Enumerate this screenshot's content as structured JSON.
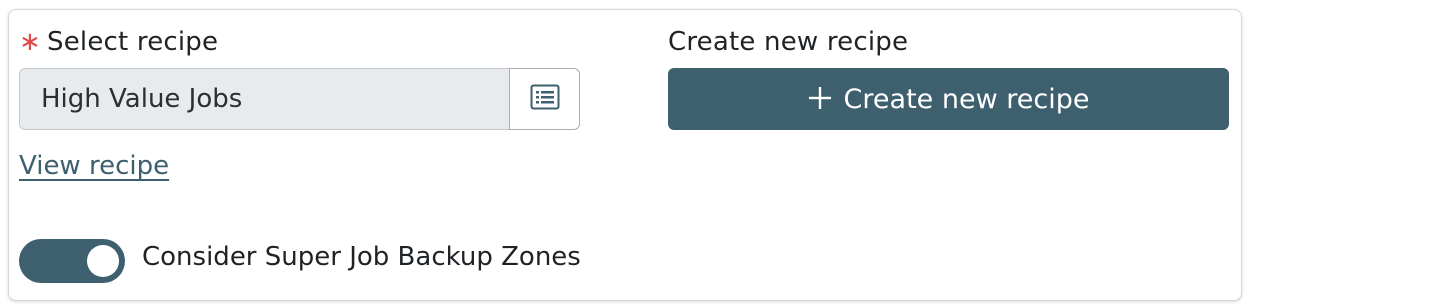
{
  "select_recipe": {
    "required_marker": "∗",
    "label": "Select recipe",
    "current_value": "High Value Jobs",
    "list_button_icon": "list-icon",
    "view_link": "View recipe"
  },
  "create_recipe": {
    "label": "Create new recipe",
    "button_icon": "plus-icon",
    "button_label": "Create new recipe"
  },
  "backup_zones_toggle": {
    "label": "Consider Super Job Backup Zones",
    "checked": true
  },
  "colors": {
    "primary": "#3e5f6e",
    "required": "#e34a4a",
    "field_background": "#e8ebee"
  }
}
